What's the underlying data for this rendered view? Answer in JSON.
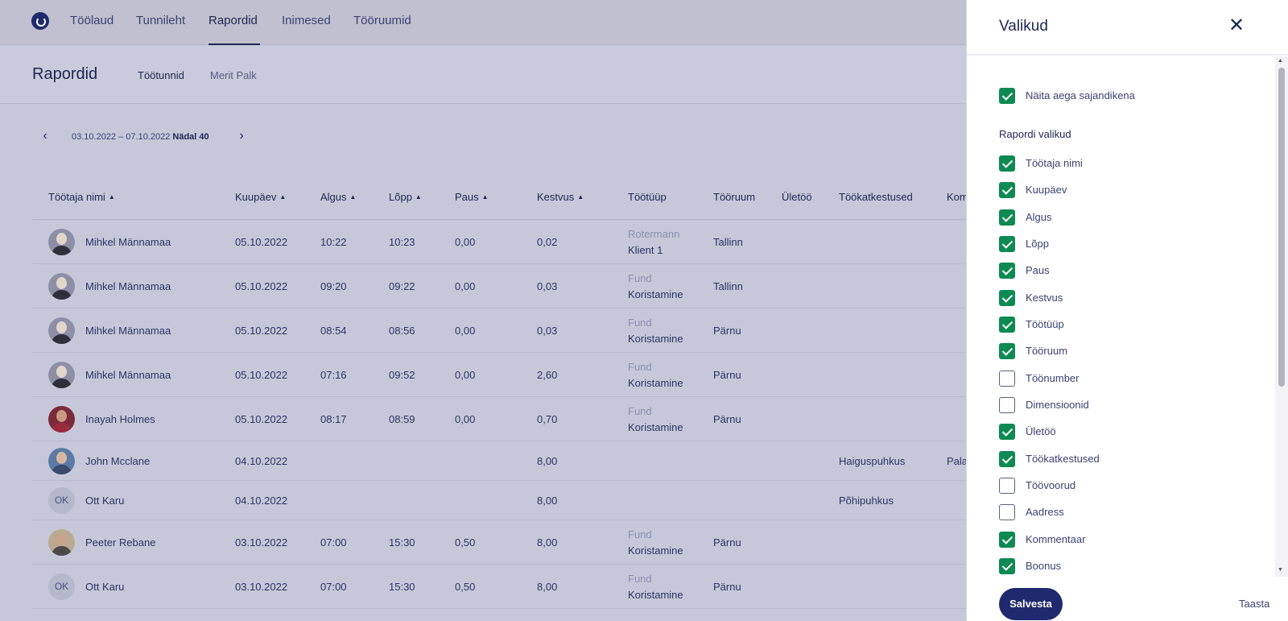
{
  "nav": {
    "items": [
      "Töölaud",
      "Tunnileht",
      "Rapordid",
      "Inimesed",
      "Tööruumid"
    ],
    "active": "Rapordid"
  },
  "page": {
    "title": "Rapordid",
    "subtabs": [
      "Töötunnid",
      "Merit Palk"
    ]
  },
  "date": {
    "range": "03.10.2022 – 07.10.2022",
    "week": "Nädal 40"
  },
  "table": {
    "columns": [
      "Töötaja nimi",
      "Kuupäev",
      "Algus",
      "Lõpp",
      "Paus",
      "Kestvus",
      "Töötüüp",
      "Tööruum",
      "Ületöö",
      "Töökatkestused",
      "Kom"
    ],
    "rows": [
      {
        "name": "Mihkel Männamaa",
        "date": "05.10.2022",
        "start": "10:22",
        "end": "10:23",
        "pause": "0,00",
        "duration": "0,02",
        "type_top": "Rotermann",
        "type": "Klient 1",
        "room": "Tallinn",
        "overtime": "",
        "interruption": "",
        "comment": ""
      },
      {
        "name": "Mihkel Männamaa",
        "date": "05.10.2022",
        "start": "09:20",
        "end": "09:22",
        "pause": "0,00",
        "duration": "0,03",
        "type_top": "Fund",
        "type": "Koristamine",
        "room": "Tallinn",
        "overtime": "",
        "interruption": "",
        "comment": ""
      },
      {
        "name": "Mihkel Männamaa",
        "date": "05.10.2022",
        "start": "08:54",
        "end": "08:56",
        "pause": "0,00",
        "duration": "0,03",
        "type_top": "Fund",
        "type": "Koristamine",
        "room": "Pärnu",
        "overtime": "",
        "interruption": "",
        "comment": ""
      },
      {
        "name": "Mihkel Männamaa",
        "date": "05.10.2022",
        "start": "07:16",
        "end": "09:52",
        "pause": "0,00",
        "duration": "2,60",
        "type_top": "Fund",
        "type": "Koristamine",
        "room": "Pärnu",
        "overtime": "",
        "interruption": "",
        "comment": ""
      },
      {
        "name": "Inayah Holmes",
        "date": "05.10.2022",
        "start": "08:17",
        "end": "08:59",
        "pause": "0,00",
        "duration": "0,70",
        "type_top": "Fund",
        "type": "Koristamine",
        "room": "Pärnu",
        "overtime": "",
        "interruption": "",
        "comment": ""
      },
      {
        "name": "John Mcclane",
        "date": "04.10.2022",
        "start": "",
        "end": "",
        "pause": "",
        "duration": "8,00",
        "type_top": "",
        "type": "",
        "room": "",
        "overtime": "",
        "interruption": "Haiguspuhkus",
        "comment": "Pala"
      },
      {
        "name": "Ott Karu",
        "initials": "OK",
        "date": "04.10.2022",
        "start": "",
        "end": "",
        "pause": "",
        "duration": "8,00",
        "type_top": "",
        "type": "",
        "room": "",
        "overtime": "",
        "interruption": "Põhipuhkus",
        "comment": ""
      },
      {
        "name": "Peeter Rebane",
        "date": "03.10.2022",
        "start": "07:00",
        "end": "15:30",
        "pause": "0,50",
        "duration": "8,00",
        "type_top": "Fund",
        "type": "Koristamine",
        "room": "Pärnu",
        "overtime": "",
        "interruption": "",
        "comment": ""
      },
      {
        "name": "Ott Karu",
        "initials": "OK",
        "date": "03.10.2022",
        "start": "07:00",
        "end": "15:30",
        "pause": "0,50",
        "duration": "8,00",
        "type_top": "Fund",
        "type": "Koristamine",
        "room": "Pärnu",
        "overtime": "",
        "interruption": "",
        "comment": ""
      }
    ]
  },
  "panel": {
    "title": "Valikud",
    "show_percent": {
      "label": "Näita aega sajandikena",
      "checked": true
    },
    "section_label": "Rapordi valikud",
    "options": [
      {
        "label": "Töötaja nimi",
        "checked": true
      },
      {
        "label": "Kuupäev",
        "checked": true
      },
      {
        "label": "Algus",
        "checked": true
      },
      {
        "label": "Lõpp",
        "checked": true
      },
      {
        "label": "Paus",
        "checked": true
      },
      {
        "label": "Kestvus",
        "checked": true
      },
      {
        "label": "Töötüüp",
        "checked": true
      },
      {
        "label": "Tööruum",
        "checked": true
      },
      {
        "label": "Töönumber",
        "checked": false
      },
      {
        "label": "Dimensioonid",
        "checked": false
      },
      {
        "label": "Ületöö",
        "checked": true
      },
      {
        "label": "Töökatkestused",
        "checked": true
      },
      {
        "label": "Töövoorud",
        "checked": false
      },
      {
        "label": "Aadress",
        "checked": false
      },
      {
        "label": "Kommentaar",
        "checked": true
      },
      {
        "label": "Boonus",
        "checked": true
      }
    ],
    "save_label": "Salvesta",
    "reset_label": "Taasta"
  },
  "colors": {
    "accent": "#1f2a6e",
    "checkbox_on": "#0d8a53",
    "overlay_bg": "#c6c8da"
  }
}
